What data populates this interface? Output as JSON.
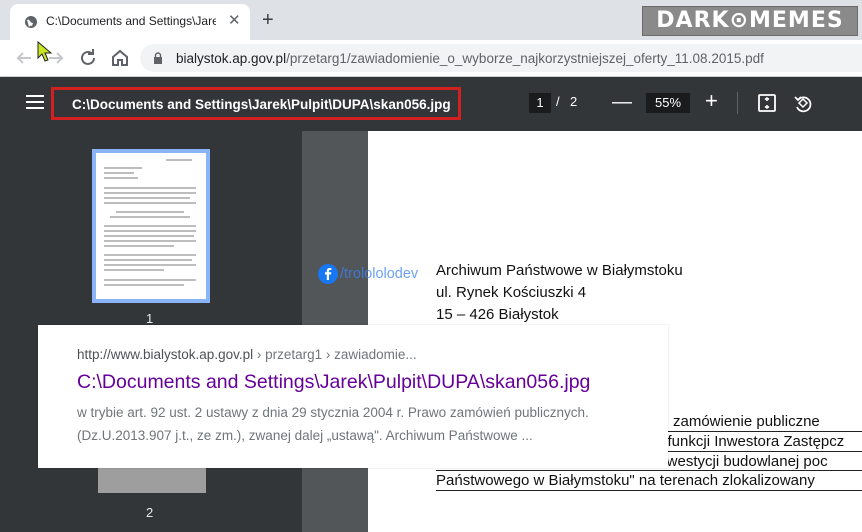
{
  "browser": {
    "tab": {
      "title": "C:\\Documents and Settings\\Jarek\\Pulpit\\DUPA\\skan056.jpg",
      "close": "✕"
    },
    "new_tab": "+",
    "url": {
      "host": "bialystok.ap.gov.pl",
      "path": "/przetarg1/zawiadomienie_o_wyborze_najkorzystniejszej_oferty_11.08.2015.pdf"
    },
    "icons": {
      "back": "arrow-left-icon",
      "forward": "arrow-right-icon",
      "reload": "reload-icon",
      "home": "home-icon",
      "lock": "lock-icon"
    }
  },
  "watermark": "DARK⊙MEMES",
  "pdf_viewer": {
    "title": "C:\\Documents and Settings\\Jarek\\Pulpit\\DUPA\\skan056.jpg",
    "page_current": "1",
    "page_separator": "/",
    "page_total": "2",
    "zoom": "55%",
    "highlight_color": "#d21f1f",
    "thumbnails": [
      "1",
      "2"
    ]
  },
  "document": {
    "address_lines": [
      "Archiwum Państwowe w Białymstoku",
      "ul. Rynek Kościuszki 4",
      "15 – 426 Białystok"
    ],
    "body_lines": [
      "zamówienie    publiczne",
      "e funkcji Inwestora Zastępcz",
      "inwestycji   budowlanej   poc",
      "Państwowego w Białymstoku\" na terenach zlokalizowany"
    ]
  },
  "social_tag": "/trolololodev",
  "search_result": {
    "url": "http://www.bialystok.ap.gov.pl",
    "crumbs": " › przetarg1 › zawiadomie...",
    "title": "C:\\Documents and Settings\\Jarek\\Pulpit\\DUPA\\skan056.jpg",
    "description_lines": [
      "w trybie art. 92 ust. 2 ustawy z dnia 29 stycznia 2004 r. Prawo zamówień publicznych.",
      "(Dz.U.2013.907 j.t., ze zm.), zwanej dalej „ustawą\". Archiwum Państwowe ..."
    ]
  }
}
